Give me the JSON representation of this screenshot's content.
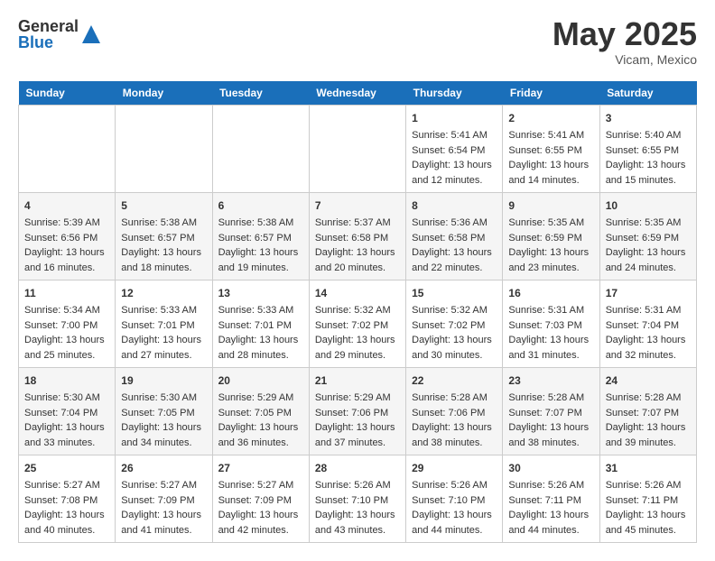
{
  "header": {
    "logo_general": "General",
    "logo_blue": "Blue",
    "month": "May 2025",
    "location": "Vicam, Mexico"
  },
  "days_of_week": [
    "Sunday",
    "Monday",
    "Tuesday",
    "Wednesday",
    "Thursday",
    "Friday",
    "Saturday"
  ],
  "weeks": [
    [
      {
        "day": "",
        "content": ""
      },
      {
        "day": "",
        "content": ""
      },
      {
        "day": "",
        "content": ""
      },
      {
        "day": "",
        "content": ""
      },
      {
        "day": "1",
        "content": "Sunrise: 5:41 AM\nSunset: 6:54 PM\nDaylight: 13 hours and 12 minutes."
      },
      {
        "day": "2",
        "content": "Sunrise: 5:41 AM\nSunset: 6:55 PM\nDaylight: 13 hours and 14 minutes."
      },
      {
        "day": "3",
        "content": "Sunrise: 5:40 AM\nSunset: 6:55 PM\nDaylight: 13 hours and 15 minutes."
      }
    ],
    [
      {
        "day": "4",
        "content": "Sunrise: 5:39 AM\nSunset: 6:56 PM\nDaylight: 13 hours and 16 minutes."
      },
      {
        "day": "5",
        "content": "Sunrise: 5:38 AM\nSunset: 6:57 PM\nDaylight: 13 hours and 18 minutes."
      },
      {
        "day": "6",
        "content": "Sunrise: 5:38 AM\nSunset: 6:57 PM\nDaylight: 13 hours and 19 minutes."
      },
      {
        "day": "7",
        "content": "Sunrise: 5:37 AM\nSunset: 6:58 PM\nDaylight: 13 hours and 20 minutes."
      },
      {
        "day": "8",
        "content": "Sunrise: 5:36 AM\nSunset: 6:58 PM\nDaylight: 13 hours and 22 minutes."
      },
      {
        "day": "9",
        "content": "Sunrise: 5:35 AM\nSunset: 6:59 PM\nDaylight: 13 hours and 23 minutes."
      },
      {
        "day": "10",
        "content": "Sunrise: 5:35 AM\nSunset: 6:59 PM\nDaylight: 13 hours and 24 minutes."
      }
    ],
    [
      {
        "day": "11",
        "content": "Sunrise: 5:34 AM\nSunset: 7:00 PM\nDaylight: 13 hours and 25 minutes."
      },
      {
        "day": "12",
        "content": "Sunrise: 5:33 AM\nSunset: 7:01 PM\nDaylight: 13 hours and 27 minutes."
      },
      {
        "day": "13",
        "content": "Sunrise: 5:33 AM\nSunset: 7:01 PM\nDaylight: 13 hours and 28 minutes."
      },
      {
        "day": "14",
        "content": "Sunrise: 5:32 AM\nSunset: 7:02 PM\nDaylight: 13 hours and 29 minutes."
      },
      {
        "day": "15",
        "content": "Sunrise: 5:32 AM\nSunset: 7:02 PM\nDaylight: 13 hours and 30 minutes."
      },
      {
        "day": "16",
        "content": "Sunrise: 5:31 AM\nSunset: 7:03 PM\nDaylight: 13 hours and 31 minutes."
      },
      {
        "day": "17",
        "content": "Sunrise: 5:31 AM\nSunset: 7:04 PM\nDaylight: 13 hours and 32 minutes."
      }
    ],
    [
      {
        "day": "18",
        "content": "Sunrise: 5:30 AM\nSunset: 7:04 PM\nDaylight: 13 hours and 33 minutes."
      },
      {
        "day": "19",
        "content": "Sunrise: 5:30 AM\nSunset: 7:05 PM\nDaylight: 13 hours and 34 minutes."
      },
      {
        "day": "20",
        "content": "Sunrise: 5:29 AM\nSunset: 7:05 PM\nDaylight: 13 hours and 36 minutes."
      },
      {
        "day": "21",
        "content": "Sunrise: 5:29 AM\nSunset: 7:06 PM\nDaylight: 13 hours and 37 minutes."
      },
      {
        "day": "22",
        "content": "Sunrise: 5:28 AM\nSunset: 7:06 PM\nDaylight: 13 hours and 38 minutes."
      },
      {
        "day": "23",
        "content": "Sunrise: 5:28 AM\nSunset: 7:07 PM\nDaylight: 13 hours and 38 minutes."
      },
      {
        "day": "24",
        "content": "Sunrise: 5:28 AM\nSunset: 7:07 PM\nDaylight: 13 hours and 39 minutes."
      }
    ],
    [
      {
        "day": "25",
        "content": "Sunrise: 5:27 AM\nSunset: 7:08 PM\nDaylight: 13 hours and 40 minutes."
      },
      {
        "day": "26",
        "content": "Sunrise: 5:27 AM\nSunset: 7:09 PM\nDaylight: 13 hours and 41 minutes."
      },
      {
        "day": "27",
        "content": "Sunrise: 5:27 AM\nSunset: 7:09 PM\nDaylight: 13 hours and 42 minutes."
      },
      {
        "day": "28",
        "content": "Sunrise: 5:26 AM\nSunset: 7:10 PM\nDaylight: 13 hours and 43 minutes."
      },
      {
        "day": "29",
        "content": "Sunrise: 5:26 AM\nSunset: 7:10 PM\nDaylight: 13 hours and 44 minutes."
      },
      {
        "day": "30",
        "content": "Sunrise: 5:26 AM\nSunset: 7:11 PM\nDaylight: 13 hours and 44 minutes."
      },
      {
        "day": "31",
        "content": "Sunrise: 5:26 AM\nSunset: 7:11 PM\nDaylight: 13 hours and 45 minutes."
      }
    ]
  ]
}
